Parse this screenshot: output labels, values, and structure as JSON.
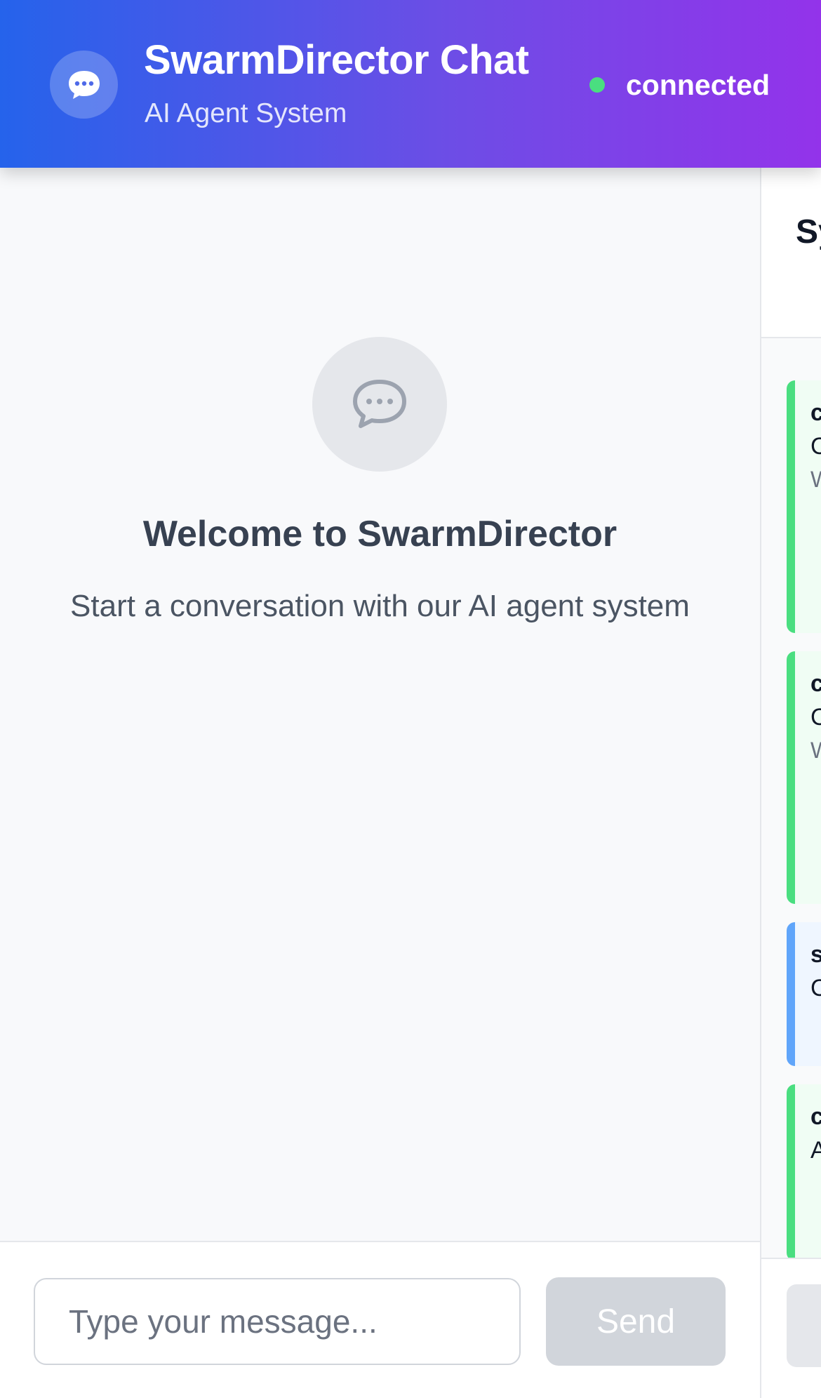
{
  "header": {
    "title": "SwarmDirector Chat",
    "subtitle": "AI Agent System",
    "status_text": "connected",
    "status_color": "#4ade80",
    "logo_icon": "chat-bubble-icon",
    "gradient": [
      "#2563eb",
      "#9333ea"
    ]
  },
  "welcome": {
    "icon": "chat-bubble-icon",
    "title": "Welcome to SwarmDirector",
    "subtitle": "Start a conversation with our AI agent system"
  },
  "composer": {
    "placeholder": "Type your message...",
    "send_label": "Send"
  },
  "activity_panel": {
    "title": "Sy Ac",
    "cards": [
      {
        "kind": "success",
        "type": "c",
        "message": "C S",
        "detail": "W c e"
      },
      {
        "kind": "success",
        "type": "c",
        "message": "C S",
        "detail": "W c e"
      },
      {
        "kind": "info",
        "type": "s",
        "message": "C ir",
        "detail": ""
      },
      {
        "kind": "success",
        "type": "c",
        "message": "A c S",
        "detail": ""
      }
    ]
  }
}
